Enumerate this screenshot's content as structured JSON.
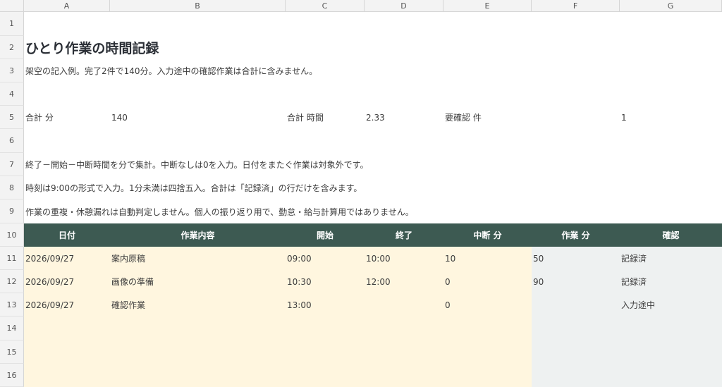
{
  "columns": [
    "A",
    "B",
    "C",
    "D",
    "E",
    "F",
    "G"
  ],
  "row_numbers": [
    "1",
    "2",
    "3",
    "4",
    "5",
    "6",
    "7",
    "8",
    "9",
    "10",
    "11",
    "12",
    "13",
    "14",
    "15",
    "16"
  ],
  "title": "ひとり作業の時間記録",
  "subtitle": "架空の記入例。完了2件で140分。入力途中の確認作業は合計に含みません。",
  "summary": {
    "total_min_label": "合計 分",
    "total_min": "140",
    "total_hours_label": "合計 時間",
    "total_hours": "2.33",
    "needs_check_label": "要確認 件",
    "needs_check": "1"
  },
  "notes": [
    "終了－開始－中断時間を分で集計。中断なしは0を入力。日付をまたぐ作業は対象外です。",
    "時刻は9:00の形式で入力。1分未満は四捨五入。合計は「記録済」の行だけを含みます。",
    "作業の重複・休憩漏れは自動判定しません。個人の振り返り用で、勤怠・給与計算用ではありません。"
  ],
  "table": {
    "headers": [
      "日付",
      "作業内容",
      "開始",
      "終了",
      "中断 分",
      "作業 分",
      "確認"
    ],
    "rows": [
      [
        "2026/09/27",
        "案内原稿",
        "09:00",
        "10:00",
        "10",
        "50",
        "記録済"
      ],
      [
        "2026/09/27",
        "画像の準備",
        "10:30",
        "12:00",
        "0",
        "90",
        "記録済"
      ],
      [
        "2026/09/27",
        "確認作業",
        "13:00",
        "",
        "0",
        "",
        "入力途中"
      ]
    ]
  },
  "colors": {
    "header_bg": "#3d5a52",
    "input_bg": "#fff6df",
    "calc_bg": "#eef1f1"
  }
}
